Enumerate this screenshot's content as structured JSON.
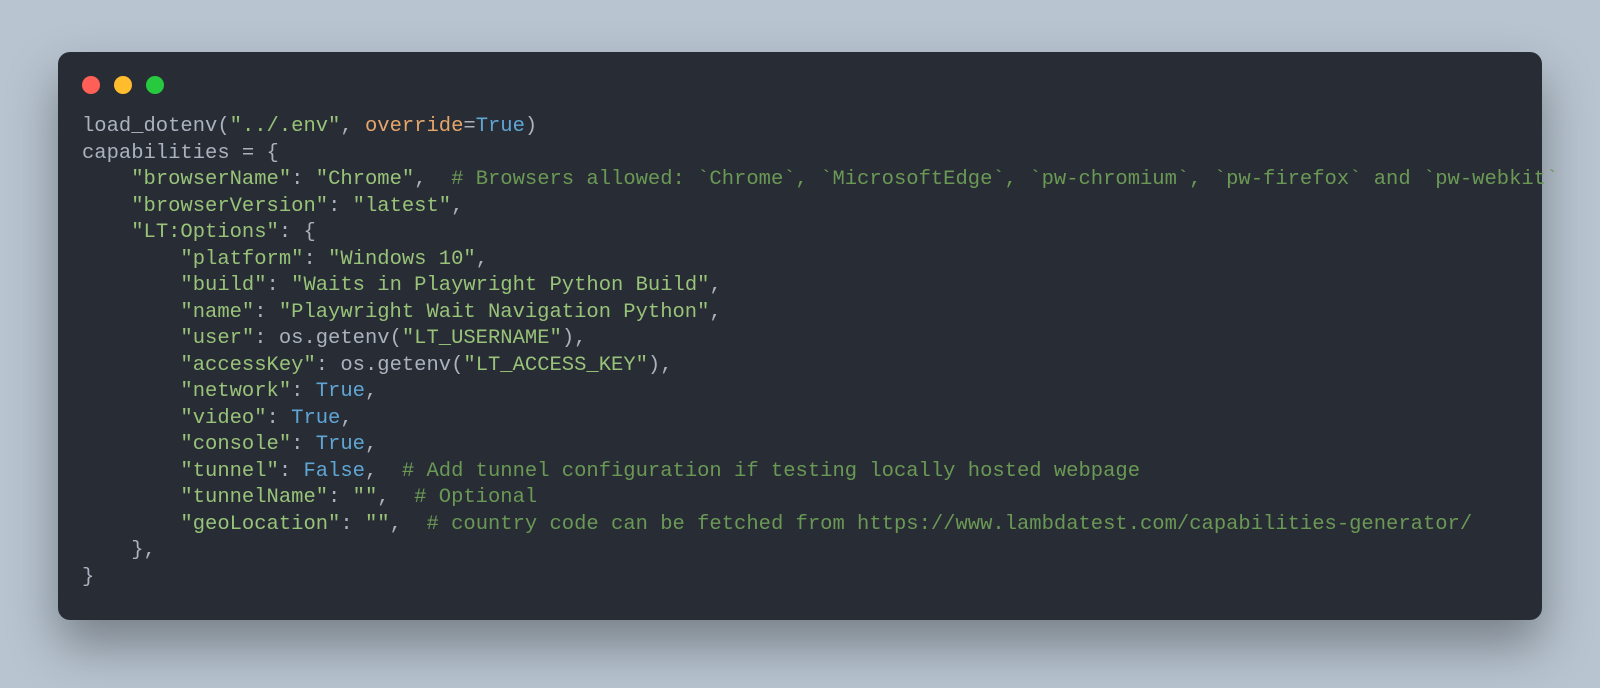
{
  "traffic": {
    "red": "#ff5f56",
    "yellow": "#ffbd2e",
    "green": "#27c93f"
  },
  "code": {
    "load_dotenv_call": "load_dotenv",
    "dotenv_path": "\"../.env\"",
    "override_kw": "override",
    "override_val": "True",
    "capabilities_var": "capabilities",
    "browserName_key": "\"browserName\"",
    "browserName_val": "\"Chrome\"",
    "browserName_comment": "# Browsers allowed: `Chrome`, `MicrosoftEdge`, `pw-chromium`, `pw-firefox` and `pw-webkit`",
    "browserVersion_key": "\"browserVersion\"",
    "browserVersion_val": "\"latest\"",
    "ltOptions_key": "\"LT:Options\"",
    "platform_key": "\"platform\"",
    "platform_val": "\"Windows 10\"",
    "build_key": "\"build\"",
    "build_val": "\"Waits in Playwright Python Build\"",
    "name_key": "\"name\"",
    "name_val": "\"Playwright Wait Navigation Python\"",
    "user_key": "\"user\"",
    "os_ref": "os",
    "getenv_call": ".getenv(",
    "lt_username": "\"LT_USERNAME\"",
    "accessKey_key": "\"accessKey\"",
    "lt_access_key": "\"LT_ACCESS_KEY\"",
    "network_key": "\"network\"",
    "video_key": "\"video\"",
    "console_key": "\"console\"",
    "true_val": "True",
    "tunnel_key": "\"tunnel\"",
    "false_val": "False",
    "tunnel_comment": "# Add tunnel configuration if testing locally hosted webpage",
    "tunnelName_key": "\"tunnelName\"",
    "empty_str": "\"\"",
    "tunnelName_comment": "# Optional",
    "geoLocation_key": "\"geoLocation\"",
    "geoLocation_comment": "# country code can be fetched from https://www.lambdatest.com/capabilities-generator/"
  }
}
